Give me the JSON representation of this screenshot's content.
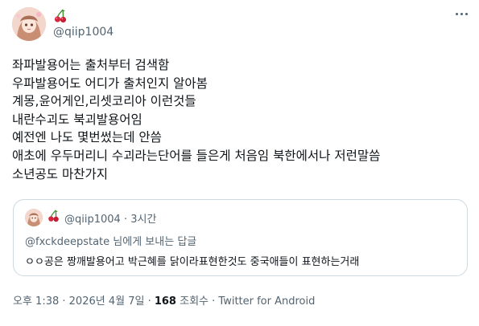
{
  "author": {
    "emoji_icon": "cherries-emoji",
    "handle": "@qiip1004"
  },
  "tweet": {
    "lines": [
      "좌파발용어는 출처부터 검색함",
      "우파발용어도 어디가 출처인지 알아봄",
      "계몽,윤어게인,리셋코리아 이런것들",
      "내란수괴도 북괴발용어임",
      "예전엔 나도 몇번썼는데 안씀",
      "애초에 우두머리니 수괴라는단어를 들은게 처음임 북한에서나 저런말씀",
      "소년공도 마찬가지"
    ]
  },
  "quote": {
    "handle": "@qiip1004",
    "separator": "·",
    "time": "3시간",
    "reply_prefix": "@fxckdeepstate",
    "reply_suffix": " 님에게 보내는 답글",
    "text": "ㅇㅇ공은 짱깨발용어고 박근혜를 닭이라표현한것도 중국애들이 표현하는거래"
  },
  "footer": {
    "time": "오후 1:38",
    "dot1": " · ",
    "date": "2026년 4월 7일",
    "dot2": " · ",
    "views_count": "168",
    "views_label": " 조회수",
    "dot3": " · ",
    "source": "Twitter for Android"
  },
  "colors": {
    "text": "#0f1419",
    "secondary": "#536471",
    "border": "#cfd9de",
    "cherry": "#d7263d"
  }
}
